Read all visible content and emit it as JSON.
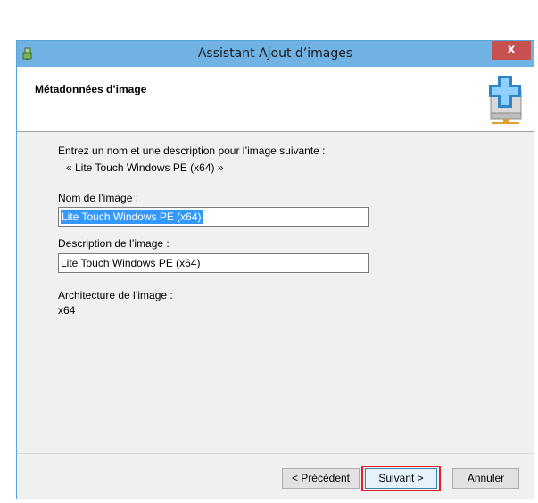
{
  "window": {
    "title": "Assistant Ajout d’images",
    "close_label": "x"
  },
  "header": {
    "title": "Métadonnées d’image"
  },
  "content": {
    "intro": "Entrez un nom et une description pour l’image suivante :",
    "image_name_quoted": "« Lite Touch Windows PE (x64) »",
    "name_label": "Nom de l’image :",
    "name_value": "Lite Touch Windows PE (x64)",
    "description_label": "Description de l’image :",
    "description_value": "Lite Touch Windows PE (x64)",
    "architecture_label": "Architecture de l’image :",
    "architecture_value": "x64"
  },
  "footer": {
    "previous": "< Précédent",
    "next": "Suivant >",
    "cancel": "Annuler"
  },
  "colors": {
    "titlebar": "#6fb2e3",
    "close": "#c75050",
    "highlight_border": "#e0202a",
    "selection": "#3399ff"
  }
}
